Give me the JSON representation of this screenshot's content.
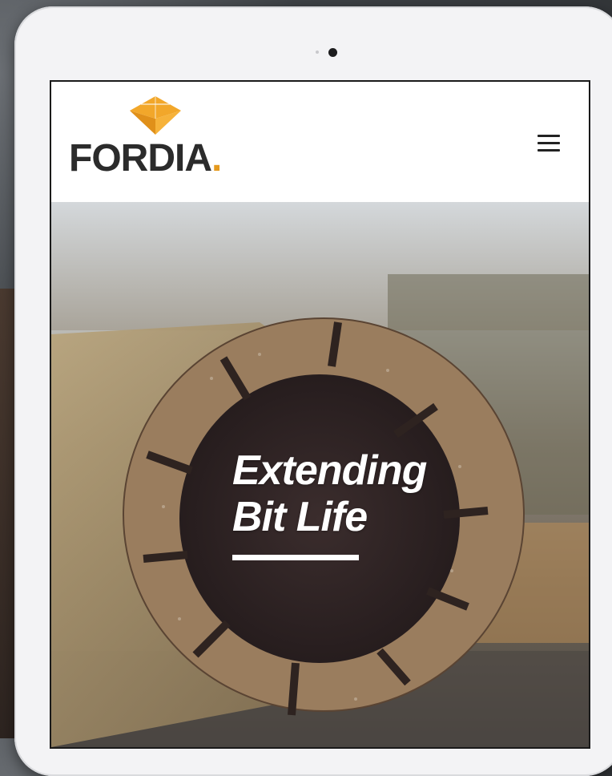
{
  "brand": {
    "name": "FORDIA",
    "dot": ".",
    "accent_color": "#e59a1e",
    "text_color": "#2b2b2b",
    "logo_icon": "diamond-drill-bit-icon"
  },
  "header": {
    "menu_icon": "hamburger-menu-icon"
  },
  "hero": {
    "title_line_1": "Extending",
    "title_line_2": "Bit Life",
    "text_color": "#ffffff"
  }
}
